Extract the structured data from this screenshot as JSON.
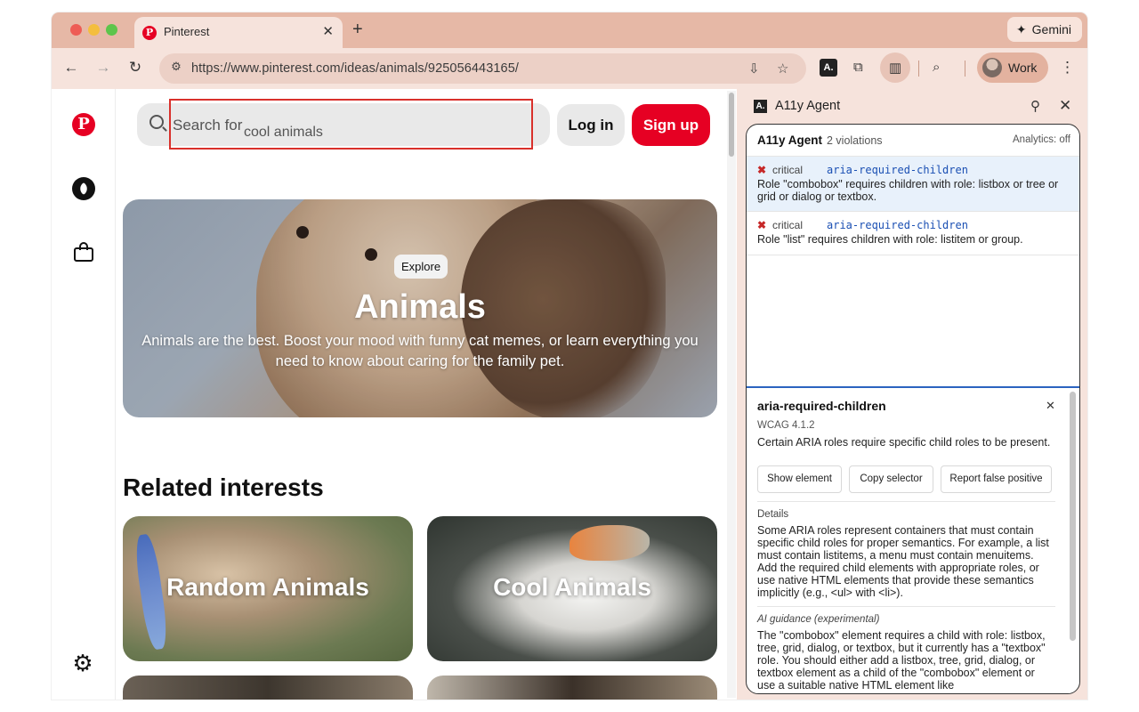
{
  "browser": {
    "tab_title": "Pinterest",
    "tab_close": "✕",
    "new_tab": "+",
    "gemini_label": "Gemini",
    "url": "https://www.pinterest.com/ideas/animals/925056443165/",
    "profile_label": "Work"
  },
  "page": {
    "search_placeholder": "Search for",
    "search_suggestion": "cool animals",
    "login_label": "Log in",
    "signup_label": "Sign up",
    "hero": {
      "badge": "Explore",
      "title": "Animals",
      "description": "Animals are the best. Boost your mood with funny cat memes, or learn everything you need to know about caring for the family pet."
    },
    "related_title": "Related interests",
    "related": [
      "Random Animals",
      "Cool Animals"
    ]
  },
  "panel": {
    "header_title": "A11y Agent",
    "box_title": "A11y Agent",
    "violation_count": "2 violations",
    "analytics": "Analytics: off",
    "violations": [
      {
        "severity": "critical",
        "rule": "aria-required-children",
        "description": "Role \"combobox\" requires children with role: listbox or tree or grid or dialog or textbox."
      },
      {
        "severity": "critical",
        "rule": "aria-required-children",
        "description": "Role \"list\" requires children with role: listitem or group."
      }
    ],
    "detail": {
      "title": "aria-required-children",
      "wcag": "WCAG 4.1.2",
      "summary": "Certain ARIA roles require specific child roles to be present.",
      "buttons": {
        "show": "Show element",
        "copy": "Copy selector",
        "report": "Report false positive"
      },
      "details_label": "Details",
      "details_text": "Some ARIA roles represent containers that must contain specific child roles for proper semantics. For example, a list must contain listitems, a menu must contain menuitems. Add the required child elements with appropriate roles, or use native HTML elements that provide these semantics implicitly (e.g., <ul> with <li>).",
      "ai_label": "AI guidance (experimental)",
      "ai_text": "The \"combobox\" element requires a child with role: listbox, tree, grid, dialog, or textbox, but it currently has a \"textbox\" role.  You should either add a listbox, tree, grid, dialog, or textbox element as a child of the \"combobox\" element or use a suitable native HTML element like"
    }
  },
  "colors": {
    "pinterest_red": "#e60023",
    "tab_strip": "#e6b8a6",
    "toolbar": "#f6e3dc",
    "highlight": "#d9302b",
    "selected_violation": "#e8f1fb",
    "critical": "#c62828",
    "rule_link": "#1a4fb3"
  }
}
